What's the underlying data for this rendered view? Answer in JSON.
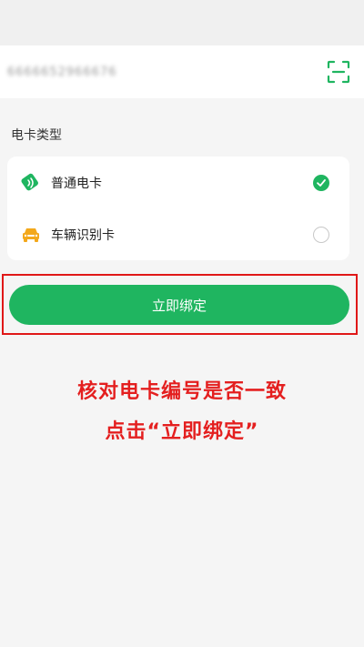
{
  "card_input": {
    "value": "6666652966676",
    "scan_icon": "scan-frame-icon",
    "scan_color": "#1fb560"
  },
  "card_type": {
    "section_label": "电卡类型",
    "options": [
      {
        "label": "普通电卡",
        "icon": "green-card-icon",
        "selected": true
      },
      {
        "label": "车辆识别卡",
        "icon": "car-icon",
        "selected": false
      }
    ]
  },
  "actions": {
    "bind_label": "立即绑定"
  },
  "instructions": {
    "line1": "核对电卡编号是否一致",
    "line2": "点击“立即绑定”"
  },
  "colors": {
    "accent": "#1fb560",
    "annotation": "#e01818",
    "car_icon": "#f3a81b"
  }
}
